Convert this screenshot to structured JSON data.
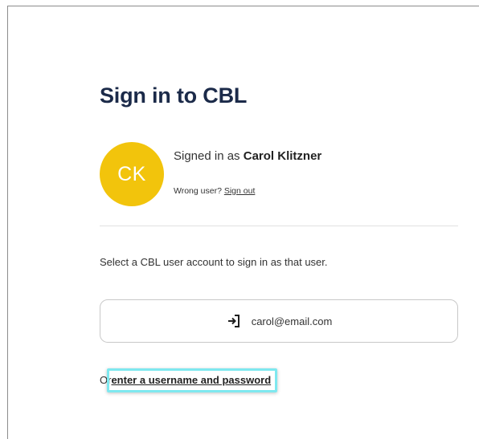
{
  "page": {
    "title": "Sign in to CBL"
  },
  "session": {
    "avatar_initials": "CK",
    "signed_in_prefix": "Signed in as",
    "user_name": "Carol Klitzner",
    "wrong_user_text": "Wrong user?",
    "sign_out_label": "Sign out"
  },
  "accounts": {
    "instruction": "Select a CBL user account to sign in as that user.",
    "items": [
      {
        "email": "carol@email.com",
        "icon": "sign-in-icon"
      }
    ]
  },
  "alternate": {
    "prefix": "Or",
    "link_label": "enter a username and password"
  },
  "colors": {
    "title": "#1b2a49",
    "avatar_bg": "#f2c40c",
    "highlight": "#7ee8ef"
  }
}
